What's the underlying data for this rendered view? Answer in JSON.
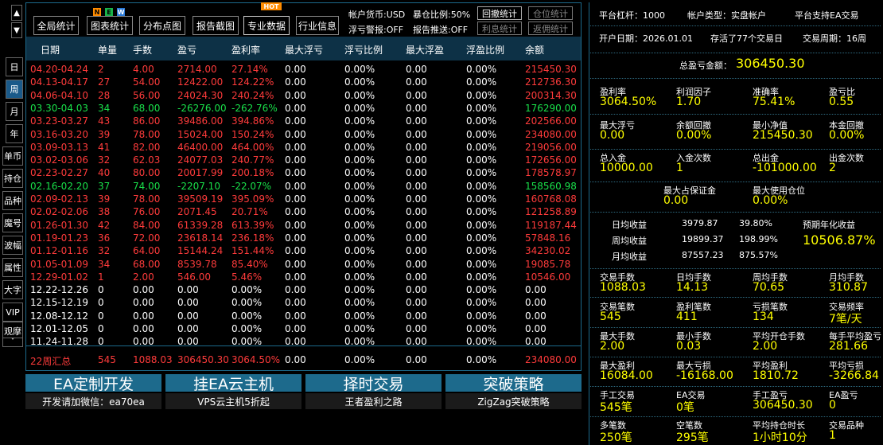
{
  "nav": {
    "up": "▲",
    "down": "▼",
    "items": [
      "日",
      "周",
      "月",
      "年",
      "单币",
      "持仓",
      "品种",
      "魔号",
      "波幅",
      "属性",
      "大字",
      "VIP",
      "观摩",
      "ˇ"
    ],
    "selected": 1
  },
  "toolbar": {
    "buttons": [
      "全局统计",
      "图表统计",
      "分布点图",
      "报告截图",
      "专业数据",
      "行业信息"
    ],
    "new_badge": [
      "N",
      "E",
      "W"
    ],
    "hot_badge": "HOT"
  },
  "account": {
    "currency": "帐户货币:USD",
    "bust_ratio": "暴仓比例:50%",
    "float_alert": "浮亏警报:OFF",
    "report_push": "报告推送:OFF",
    "btns": [
      "回撤统计",
      "仓位统计",
      "利息统计",
      "返佣统计"
    ]
  },
  "table": {
    "headers": [
      "日期",
      "单量",
      "手数",
      "盈亏",
      "盈利率",
      "最大浮亏",
      "浮亏比例",
      "最大浮盈",
      "浮盈比例",
      "余额"
    ],
    "rows": [
      [
        "04.20-04.24",
        "2",
        "4.00",
        "2714.00",
        "27.14%",
        "0.00",
        "0.00%",
        "0.00",
        "0.00%",
        "215450.30"
      ],
      [
        "04.13-04.17",
        "27",
        "54.00",
        "12422.00",
        "124.22%",
        "0.00",
        "0.00%",
        "0.00",
        "0.00%",
        "212736.30"
      ],
      [
        "04.06-04.10",
        "28",
        "56.00",
        "24024.30",
        "240.24%",
        "0.00",
        "0.00%",
        "0.00",
        "0.00%",
        "200314.30"
      ],
      [
        "03.30-04.03",
        "34",
        "68.00",
        "-26276.00",
        "-262.76%",
        "0.00",
        "0.00%",
        "0.00",
        "0.00%",
        "176290.00"
      ],
      [
        "03.23-03.27",
        "43",
        "86.00",
        "39486.00",
        "394.86%",
        "0.00",
        "0.00%",
        "0.00",
        "0.00%",
        "202566.00"
      ],
      [
        "03.16-03.20",
        "39",
        "78.00",
        "15024.00",
        "150.24%",
        "0.00",
        "0.00%",
        "0.00",
        "0.00%",
        "234080.00"
      ],
      [
        "03.09-03.13",
        "41",
        "82.00",
        "46400.00",
        "464.00%",
        "0.00",
        "0.00%",
        "0.00",
        "0.00%",
        "219056.00"
      ],
      [
        "03.02-03.06",
        "32",
        "62.03",
        "24077.03",
        "240.77%",
        "0.00",
        "0.00%",
        "0.00",
        "0.00%",
        "172656.00"
      ],
      [
        "02.23-02.27",
        "40",
        "80.00",
        "20017.99",
        "200.18%",
        "0.00",
        "0.00%",
        "0.00",
        "0.00%",
        "178578.97"
      ],
      [
        "02.16-02.20",
        "37",
        "74.00",
        "-2207.10",
        "-22.07%",
        "0.00",
        "0.00%",
        "0.00",
        "0.00%",
        "158560.98"
      ],
      [
        "02.09-02.13",
        "39",
        "78.00",
        "39509.19",
        "395.09%",
        "0.00",
        "0.00%",
        "0.00",
        "0.00%",
        "160768.08"
      ],
      [
        "02.02-02.06",
        "38",
        "76.00",
        "2071.45",
        "20.71%",
        "0.00",
        "0.00%",
        "0.00",
        "0.00%",
        "121258.89"
      ],
      [
        "01.26-01.30",
        "42",
        "84.00",
        "61339.28",
        "613.39%",
        "0.00",
        "0.00%",
        "0.00",
        "0.00%",
        "119187.44"
      ],
      [
        "01.19-01.23",
        "36",
        "72.00",
        "23618.14",
        "236.18%",
        "0.00",
        "0.00%",
        "0.00",
        "0.00%",
        "57848.16"
      ],
      [
        "01.12-01.16",
        "32",
        "64.00",
        "15144.24",
        "151.44%",
        "0.00",
        "0.00%",
        "0.00",
        "0.00%",
        "34230.02"
      ],
      [
        "01.05-01.09",
        "34",
        "68.00",
        "8539.78",
        "85.40%",
        "0.00",
        "0.00%",
        "0.00",
        "0.00%",
        "19085.78"
      ],
      [
        "12.29-01.02",
        "1",
        "2.00",
        "546.00",
        "5.46%",
        "0.00",
        "0.00%",
        "0.00",
        "0.00%",
        "10546.00"
      ],
      [
        "12.22-12.26",
        "0",
        "0.00",
        "0.00",
        "0.00%",
        "0.00",
        "0.00%",
        "0.00",
        "0.00%",
        "0.00"
      ],
      [
        "12.15-12.19",
        "0",
        "0.00",
        "0.00",
        "0.00%",
        "0.00",
        "0.00%",
        "0.00",
        "0.00%",
        "0.00"
      ],
      [
        "12.08-12.12",
        "0",
        "0.00",
        "0.00",
        "0.00%",
        "0.00",
        "0.00%",
        "0.00",
        "0.00%",
        "0.00"
      ],
      [
        "12.01-12.05",
        "0",
        "0.00",
        "0.00",
        "0.00%",
        "0.00",
        "0.00%",
        "0.00",
        "0.00%",
        "0.00"
      ],
      [
        "11.24-11.28",
        "0",
        "0.00",
        "0.00",
        "0.00%",
        "0.00",
        "0.00%",
        "0.00",
        "0.00%",
        "0.00"
      ]
    ],
    "row_kind": [
      "r",
      "r",
      "r",
      "g",
      "r",
      "r",
      "r",
      "r",
      "r",
      "g",
      "r",
      "r",
      "r",
      "r",
      "r",
      "r",
      "r",
      "w",
      "w",
      "w",
      "w",
      "w"
    ],
    "summary": [
      "22周汇总",
      "545",
      "1088.03",
      "306450.30",
      "3064.50%",
      "0.00",
      "0.00%",
      "0.00",
      "0.00%",
      "234080.00"
    ]
  },
  "banners": [
    {
      "title": "EA定制开发",
      "sub": "开发请加微信：ea70ea"
    },
    {
      "title": "挂EA云主机",
      "sub": "VPS云主机5折起"
    },
    {
      "title": "择时交易",
      "sub": "王者盈利之路"
    },
    {
      "title": "突破策略",
      "sub": "ZigZag突破策略"
    }
  ],
  "right": {
    "leverage": "平台杠杆：1000",
    "acct_type": "帐户类型：实盘帐户",
    "ea": "平台支持EA交易",
    "open_date": "开户日期：2026.01.01",
    "survived": "存活了77个交易日",
    "cycle": "交易周期：16周",
    "total_label": "总盈亏金额：",
    "total_value": "306450.30",
    "g1": [
      [
        "盈利率",
        "3064.50%"
      ],
      [
        "利润因子",
        "1.70"
      ],
      [
        "准确率",
        "75.41%"
      ],
      [
        "盈亏比",
        "0.55"
      ]
    ],
    "g2": [
      [
        "最大浮亏",
        "0.00"
      ],
      [
        "余额回撤",
        "0.00%"
      ],
      [
        "最小净值",
        "215450.30"
      ],
      [
        "本金回撤",
        "0.00%"
      ]
    ],
    "g3": [
      [
        "总入金",
        "10000.00"
      ],
      [
        "入金次数",
        "1"
      ],
      [
        "总出金",
        "-101000.00"
      ],
      [
        "出金次数",
        "2"
      ]
    ],
    "g4": [
      [
        "最大占保证金",
        "0.00"
      ],
      [
        "最大使用仓位",
        "0.00%"
      ]
    ],
    "avg": [
      [
        "日均收益",
        "3979.87",
        "39.80%"
      ],
      [
        "周均收益",
        "19899.37",
        "198.99%"
      ],
      [
        "月均收益",
        "87557.23",
        "875.57%"
      ]
    ],
    "annual_label": "预期年化收益",
    "annual_value": "10506.87%",
    "g5": [
      [
        "交易手数",
        "1088.03"
      ],
      [
        "日均手数",
        "14.13"
      ],
      [
        "周均手数",
        "70.65"
      ],
      [
        "月均手数",
        "310.87"
      ]
    ],
    "g6": [
      [
        "交易笔数",
        "545"
      ],
      [
        "盈利笔数",
        "411"
      ],
      [
        "亏损笔数",
        "134"
      ],
      [
        "交易频率",
        "7笔/天"
      ]
    ],
    "g7": [
      [
        "最大手数",
        "2.00"
      ],
      [
        "最小手数",
        "0.03"
      ],
      [
        "平均开仓手数",
        "2.00"
      ],
      [
        "每手平均盈亏",
        "281.66"
      ]
    ],
    "g8": [
      [
        "最大盈利",
        "16084.00"
      ],
      [
        "最大亏损",
        "-16168.00"
      ],
      [
        "平均盈利",
        "1810.72"
      ],
      [
        "平均亏损",
        "-3266.84"
      ]
    ],
    "g9": [
      [
        "手工交易",
        "545笔"
      ],
      [
        "EA交易",
        "0笔"
      ],
      [
        "手工盈亏",
        "306450.30"
      ],
      [
        "EA盈亏",
        "0"
      ]
    ],
    "g10": [
      [
        "多笔数",
        "250笔"
      ],
      [
        "空笔数",
        "295笔"
      ],
      [
        "平均持仓时长",
        "1小时10分"
      ],
      [
        "交易品种",
        "1"
      ]
    ]
  },
  "colors": {
    "red": "#ff3b3b",
    "green": "#19e04a",
    "yellow": "#ffff00",
    "header_bg": "#0d3146",
    "border": "#1c6a8c"
  }
}
